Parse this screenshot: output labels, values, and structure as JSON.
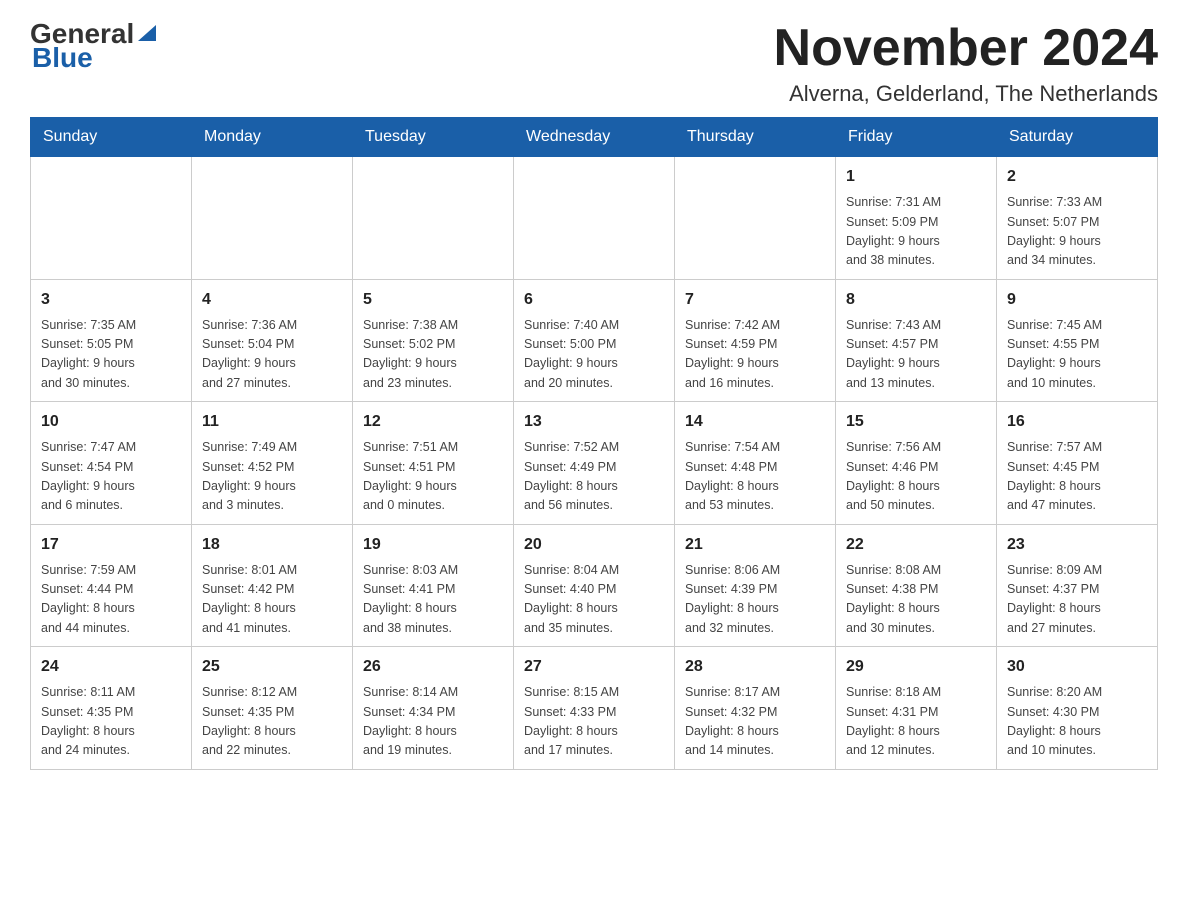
{
  "logo": {
    "text_black": "General",
    "text_blue": "Blue",
    "tagline": "Blue"
  },
  "title": "November 2024",
  "location": "Alverna, Gelderland, The Netherlands",
  "weekdays": [
    "Sunday",
    "Monday",
    "Tuesday",
    "Wednesday",
    "Thursday",
    "Friday",
    "Saturday"
  ],
  "weeks": [
    [
      {
        "day": "",
        "info": ""
      },
      {
        "day": "",
        "info": ""
      },
      {
        "day": "",
        "info": ""
      },
      {
        "day": "",
        "info": ""
      },
      {
        "day": "",
        "info": ""
      },
      {
        "day": "1",
        "info": "Sunrise: 7:31 AM\nSunset: 5:09 PM\nDaylight: 9 hours\nand 38 minutes."
      },
      {
        "day": "2",
        "info": "Sunrise: 7:33 AM\nSunset: 5:07 PM\nDaylight: 9 hours\nand 34 minutes."
      }
    ],
    [
      {
        "day": "3",
        "info": "Sunrise: 7:35 AM\nSunset: 5:05 PM\nDaylight: 9 hours\nand 30 minutes."
      },
      {
        "day": "4",
        "info": "Sunrise: 7:36 AM\nSunset: 5:04 PM\nDaylight: 9 hours\nand 27 minutes."
      },
      {
        "day": "5",
        "info": "Sunrise: 7:38 AM\nSunset: 5:02 PM\nDaylight: 9 hours\nand 23 minutes."
      },
      {
        "day": "6",
        "info": "Sunrise: 7:40 AM\nSunset: 5:00 PM\nDaylight: 9 hours\nand 20 minutes."
      },
      {
        "day": "7",
        "info": "Sunrise: 7:42 AM\nSunset: 4:59 PM\nDaylight: 9 hours\nand 16 minutes."
      },
      {
        "day": "8",
        "info": "Sunrise: 7:43 AM\nSunset: 4:57 PM\nDaylight: 9 hours\nand 13 minutes."
      },
      {
        "day": "9",
        "info": "Sunrise: 7:45 AM\nSunset: 4:55 PM\nDaylight: 9 hours\nand 10 minutes."
      }
    ],
    [
      {
        "day": "10",
        "info": "Sunrise: 7:47 AM\nSunset: 4:54 PM\nDaylight: 9 hours\nand 6 minutes."
      },
      {
        "day": "11",
        "info": "Sunrise: 7:49 AM\nSunset: 4:52 PM\nDaylight: 9 hours\nand 3 minutes."
      },
      {
        "day": "12",
        "info": "Sunrise: 7:51 AM\nSunset: 4:51 PM\nDaylight: 9 hours\nand 0 minutes."
      },
      {
        "day": "13",
        "info": "Sunrise: 7:52 AM\nSunset: 4:49 PM\nDaylight: 8 hours\nand 56 minutes."
      },
      {
        "day": "14",
        "info": "Sunrise: 7:54 AM\nSunset: 4:48 PM\nDaylight: 8 hours\nand 53 minutes."
      },
      {
        "day": "15",
        "info": "Sunrise: 7:56 AM\nSunset: 4:46 PM\nDaylight: 8 hours\nand 50 minutes."
      },
      {
        "day": "16",
        "info": "Sunrise: 7:57 AM\nSunset: 4:45 PM\nDaylight: 8 hours\nand 47 minutes."
      }
    ],
    [
      {
        "day": "17",
        "info": "Sunrise: 7:59 AM\nSunset: 4:44 PM\nDaylight: 8 hours\nand 44 minutes."
      },
      {
        "day": "18",
        "info": "Sunrise: 8:01 AM\nSunset: 4:42 PM\nDaylight: 8 hours\nand 41 minutes."
      },
      {
        "day": "19",
        "info": "Sunrise: 8:03 AM\nSunset: 4:41 PM\nDaylight: 8 hours\nand 38 minutes."
      },
      {
        "day": "20",
        "info": "Sunrise: 8:04 AM\nSunset: 4:40 PM\nDaylight: 8 hours\nand 35 minutes."
      },
      {
        "day": "21",
        "info": "Sunrise: 8:06 AM\nSunset: 4:39 PM\nDaylight: 8 hours\nand 32 minutes."
      },
      {
        "day": "22",
        "info": "Sunrise: 8:08 AM\nSunset: 4:38 PM\nDaylight: 8 hours\nand 30 minutes."
      },
      {
        "day": "23",
        "info": "Sunrise: 8:09 AM\nSunset: 4:37 PM\nDaylight: 8 hours\nand 27 minutes."
      }
    ],
    [
      {
        "day": "24",
        "info": "Sunrise: 8:11 AM\nSunset: 4:35 PM\nDaylight: 8 hours\nand 24 minutes."
      },
      {
        "day": "25",
        "info": "Sunrise: 8:12 AM\nSunset: 4:35 PM\nDaylight: 8 hours\nand 22 minutes."
      },
      {
        "day": "26",
        "info": "Sunrise: 8:14 AM\nSunset: 4:34 PM\nDaylight: 8 hours\nand 19 minutes."
      },
      {
        "day": "27",
        "info": "Sunrise: 8:15 AM\nSunset: 4:33 PM\nDaylight: 8 hours\nand 17 minutes."
      },
      {
        "day": "28",
        "info": "Sunrise: 8:17 AM\nSunset: 4:32 PM\nDaylight: 8 hours\nand 14 minutes."
      },
      {
        "day": "29",
        "info": "Sunrise: 8:18 AM\nSunset: 4:31 PM\nDaylight: 8 hours\nand 12 minutes."
      },
      {
        "day": "30",
        "info": "Sunrise: 8:20 AM\nSunset: 4:30 PM\nDaylight: 8 hours\nand 10 minutes."
      }
    ]
  ]
}
